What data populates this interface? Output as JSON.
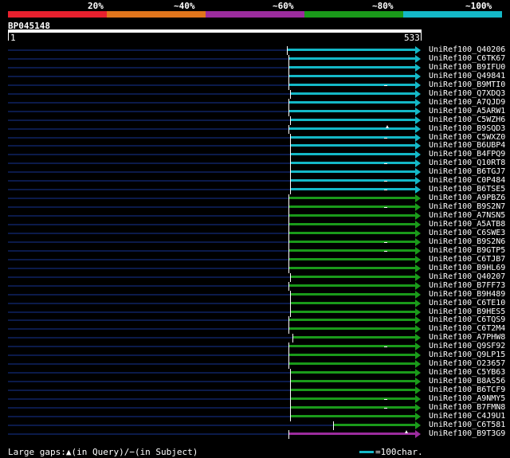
{
  "legend": {
    "segments": [
      {
        "label": "20%",
        "color": "#e8202e"
      },
      {
        "label": "~40%",
        "color": "#e0751c"
      },
      {
        "label": "~60%",
        "color": "#9c2c9e"
      },
      {
        "label": "~80%",
        "color": "#1a9a1a"
      },
      {
        "label": "~100%",
        "color": "#14b8c7"
      }
    ]
  },
  "query": {
    "name": "BP045148",
    "start": "1",
    "end": "533"
  },
  "hits": [
    {
      "name": "UniRef100_Q40206",
      "color": "#14b8c7",
      "start": 360,
      "gap": null
    },
    {
      "name": "UniRef100_C6TK67",
      "color": "#14b8c7",
      "start": 362,
      "gap": null
    },
    {
      "name": "UniRef100_B9IFU0",
      "color": "#14b8c7",
      "start": 362,
      "gap": null
    },
    {
      "name": "UniRef100_Q49841",
      "color": "#14b8c7",
      "start": 362,
      "gap": null
    },
    {
      "name": "UniRef100_B9MTI0",
      "color": "#14b8c7",
      "start": 362,
      "gap": "dash"
    },
    {
      "name": "UniRef100_Q7XDQ3",
      "color": "#14b8c7",
      "start": 364,
      "gap": null
    },
    {
      "name": "UniRef100_A7QJD9",
      "color": "#14b8c7",
      "start": 362,
      "gap": null
    },
    {
      "name": "UniRef100_A5ARW1",
      "color": "#14b8c7",
      "start": 362,
      "gap": null
    },
    {
      "name": "UniRef100_C5WZH6",
      "color": "#14b8c7",
      "start": 364,
      "gap": null
    },
    {
      "name": "UniRef100_B9SQD3",
      "color": "#14b8c7",
      "start": 362,
      "gap": "query"
    },
    {
      "name": "UniRef100_C5WXZ0",
      "color": "#14b8c7",
      "start": 364,
      "gap": "dash"
    },
    {
      "name": "UniRef100_B6UBP4",
      "color": "#14b8c7",
      "start": 364,
      "gap": null
    },
    {
      "name": "UniRef100_B4FPQ9",
      "color": "#14b8c7",
      "start": 364,
      "gap": null
    },
    {
      "name": "UniRef100_Q10RT8",
      "color": "#14b8c7",
      "start": 364,
      "gap": "dash"
    },
    {
      "name": "UniRef100_B6TGJ7",
      "color": "#14b8c7",
      "start": 364,
      "gap": null
    },
    {
      "name": "UniRef100_C0P484",
      "color": "#14b8c7",
      "start": 364,
      "gap": "dash"
    },
    {
      "name": "UniRef100_B6TSE5",
      "color": "#14b8c7",
      "start": 364,
      "gap": "dash"
    },
    {
      "name": "UniRef100_A9PBZ6",
      "color": "#1a9a1a",
      "start": 362,
      "gap": null
    },
    {
      "name": "UniRef100_B9S2N7",
      "color": "#1a9a1a",
      "start": 362,
      "gap": "dash"
    },
    {
      "name": "UniRef100_A7NSN5",
      "color": "#1a9a1a",
      "start": 362,
      "gap": null
    },
    {
      "name": "UniRef100_A5ATB8",
      "color": "#1a9a1a",
      "start": 362,
      "gap": null
    },
    {
      "name": "UniRef100_C6SWE3",
      "color": "#1a9a1a",
      "start": 362,
      "gap": null
    },
    {
      "name": "UniRef100_B9S2N6",
      "color": "#1a9a1a",
      "start": 362,
      "gap": "dash"
    },
    {
      "name": "UniRef100_B9GTP5",
      "color": "#1a9a1a",
      "start": 362,
      "gap": "dash"
    },
    {
      "name": "UniRef100_C6TJB7",
      "color": "#1a9a1a",
      "start": 362,
      "gap": null
    },
    {
      "name": "UniRef100_B9HL69",
      "color": "#1a9a1a",
      "start": 362,
      "gap": null
    },
    {
      "name": "UniRef100_Q40207",
      "color": "#1a9a1a",
      "start": 364,
      "gap": null
    },
    {
      "name": "UniRef100_B7FF73",
      "color": "#1a9a1a",
      "start": 362,
      "gap": null
    },
    {
      "name": "UniRef100_B9H489",
      "color": "#1a9a1a",
      "start": 364,
      "gap": null
    },
    {
      "name": "UniRef100_C6TE10",
      "color": "#1a9a1a",
      "start": 364,
      "gap": null
    },
    {
      "name": "UniRef100_B9HES5",
      "color": "#1a9a1a",
      "start": 364,
      "gap": null
    },
    {
      "name": "UniRef100_C6TQS9",
      "color": "#1a9a1a",
      "start": 362,
      "gap": null
    },
    {
      "name": "UniRef100_C6T2M4",
      "color": "#1a9a1a",
      "start": 362,
      "gap": null
    },
    {
      "name": "UniRef100_A7PHW8",
      "color": "#1a9a1a",
      "start": 367,
      "gap": null
    },
    {
      "name": "UniRef100_Q9SF92",
      "color": "#1a9a1a",
      "start": 362,
      "gap": "dash"
    },
    {
      "name": "UniRef100_Q9LP15",
      "color": "#1a9a1a",
      "start": 362,
      "gap": null
    },
    {
      "name": "UniRef100_O23657",
      "color": "#1a9a1a",
      "start": 362,
      "gap": null
    },
    {
      "name": "UniRef100_C5YB63",
      "color": "#1a9a1a",
      "start": 364,
      "gap": null
    },
    {
      "name": "UniRef100_B8AS56",
      "color": "#1a9a1a",
      "start": 364,
      "gap": null
    },
    {
      "name": "UniRef100_B6TCF9",
      "color": "#1a9a1a",
      "start": 364,
      "gap": null
    },
    {
      "name": "UniRef100_A9NMY5",
      "color": "#1a9a1a",
      "start": 364,
      "gap": "dash"
    },
    {
      "name": "UniRef100_B7FMN8",
      "color": "#1a9a1a",
      "start": 364,
      "gap": "dash"
    },
    {
      "name": "UniRef100_C4J9U1",
      "color": "#1a9a1a",
      "start": 364,
      "gap": null
    },
    {
      "name": "UniRef100_C6T581",
      "color": "#1a9a1a",
      "start": 418,
      "gap": null
    },
    {
      "name": "UniRef100_B9T3G9",
      "color": "#9c2c9e",
      "start": 362,
      "gap": "query"
    }
  ],
  "footer": {
    "gaps_label": "Large gaps:▲(in Query)/−(in Subject)",
    "scale_label": "=100char."
  },
  "colors": {
    "background": "#000000",
    "track": "#0b1a4a"
  }
}
